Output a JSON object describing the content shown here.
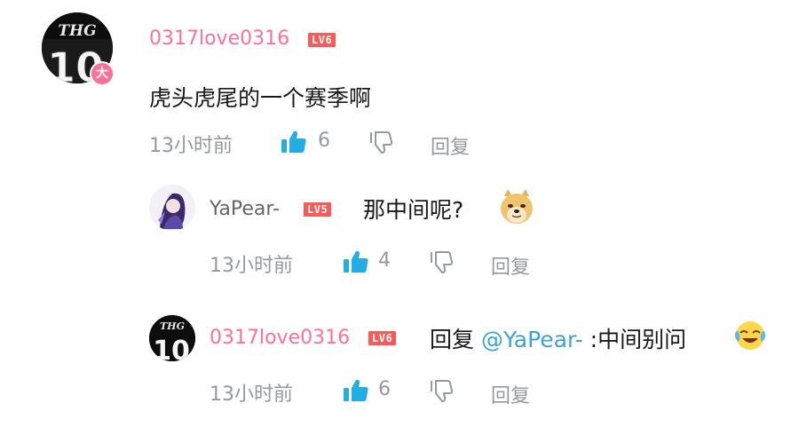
{
  "comments": [
    {
      "username": "0317love0316",
      "username_color": "#fb7299",
      "level": "LV6",
      "avatar_text": "THG",
      "avatar_number": "10",
      "avatar_badge": "大",
      "content": "虎头虎尾的一个赛季啊",
      "time": "13小时前",
      "likes": "6",
      "reply_label": "回复"
    },
    {
      "username": "YaPear-",
      "username_color": "#61666d",
      "level": "LV5",
      "content": "那中间呢?",
      "emoji": "doge",
      "time": "13小时前",
      "likes": "4",
      "reply_label": "回复"
    },
    {
      "username": "0317love0316",
      "username_color": "#fb7299",
      "level": "LV6",
      "avatar_text": "THG",
      "avatar_number": "10",
      "content_prefix": "回复",
      "mention": "@YaPear-",
      "content_suffix": ":中间别问",
      "emoji": "crying-laughing",
      "time": "13小时前",
      "likes": "6",
      "reply_label": "回复"
    }
  ],
  "colors": {
    "like": "#23ade5",
    "meta": "#9499a0",
    "mention": "#3ba3d6",
    "level_badge": "#fa5a57"
  }
}
